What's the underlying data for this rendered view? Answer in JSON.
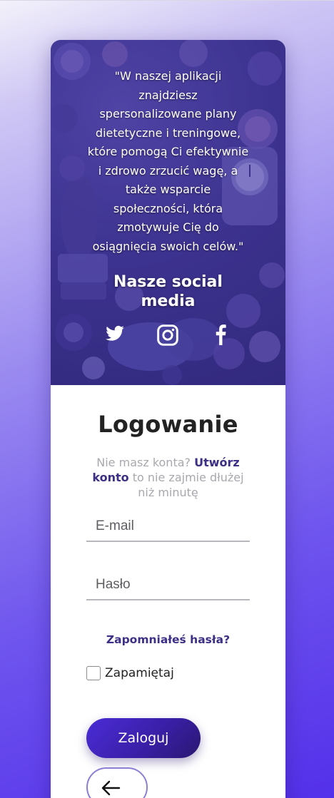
{
  "hero": {
    "quote": "\"W naszej aplikacji znajdziesz spersonalizowane plany dietetyczne i treningowe, które pomogą Ci efektywnie i zdrowo zrzucić wagę, a także wsparcie społeczności, która zmotywuje Cię do osiągnięcia swoich celów.\"",
    "social_title": "Nasze social media",
    "social_icons": [
      "twitter-icon",
      "instagram-icon",
      "facebook-icon"
    ]
  },
  "login": {
    "title": "Logowanie",
    "signup_prefix": "Nie masz konta?",
    "signup_link": "Utwórz konto",
    "signup_suffix": "to nie zajmie dłużej niż minutę",
    "email_placeholder": "E-mail",
    "password_placeholder": "Hasło",
    "forgot_link": "Zapomniałeś hasła?",
    "remember_label": "Zapamiętaj",
    "submit_label": "Zaloguj",
    "back_icon": "arrow-left-icon"
  },
  "colors": {
    "accent_dark": "#3b2f86",
    "button_gradient_start": "#4a2cd6",
    "button_gradient_end": "#2a1770",
    "muted_text": "#a8a8ae"
  }
}
